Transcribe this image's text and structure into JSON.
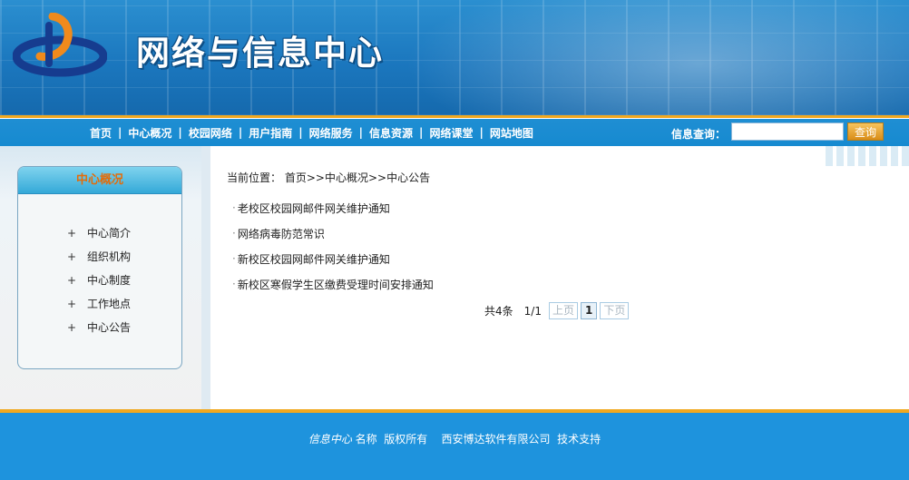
{
  "header": {
    "site_title": "网络与信息中心"
  },
  "nav": {
    "items": [
      "首页",
      "中心概况",
      "校园网络",
      "用户指南",
      "网络服务",
      "信息资源",
      "网络课堂",
      "网站地图"
    ],
    "separator": "|",
    "search_label": "信息查询：",
    "search_value": "",
    "search_button": "查询"
  },
  "sidebar": {
    "title": "中心概况",
    "items": [
      "中心简介",
      "组织机构",
      "中心制度",
      "工作地点",
      "中心公告"
    ],
    "bullet": "+"
  },
  "main": {
    "breadcrumb_label": "当前位置：",
    "breadcrumb_path": "首页>>中心概况>>中心公告",
    "news_bullet": "·",
    "news": [
      "老校区校园网邮件网关维护通知",
      "网络病毒防范常识",
      "新校区校园网邮件网关维护通知",
      "新校区寒假学生区缴费受理时间安排通知"
    ],
    "pager": {
      "total": "共4条",
      "page": "1/1",
      "prev": "上页",
      "current": "1",
      "next": "下页"
    }
  },
  "footer": {
    "org": "信息中心",
    "text": "名称  版权所有    西安博达软件有限公司  技术支持"
  },
  "colors": {
    "banner_blue": "#1b77be",
    "nav_blue": "#168ad0",
    "accent_orange": "#f0a81f",
    "sidebar_title": "#e36c0a",
    "footer_blue": "#1e93dd"
  }
}
